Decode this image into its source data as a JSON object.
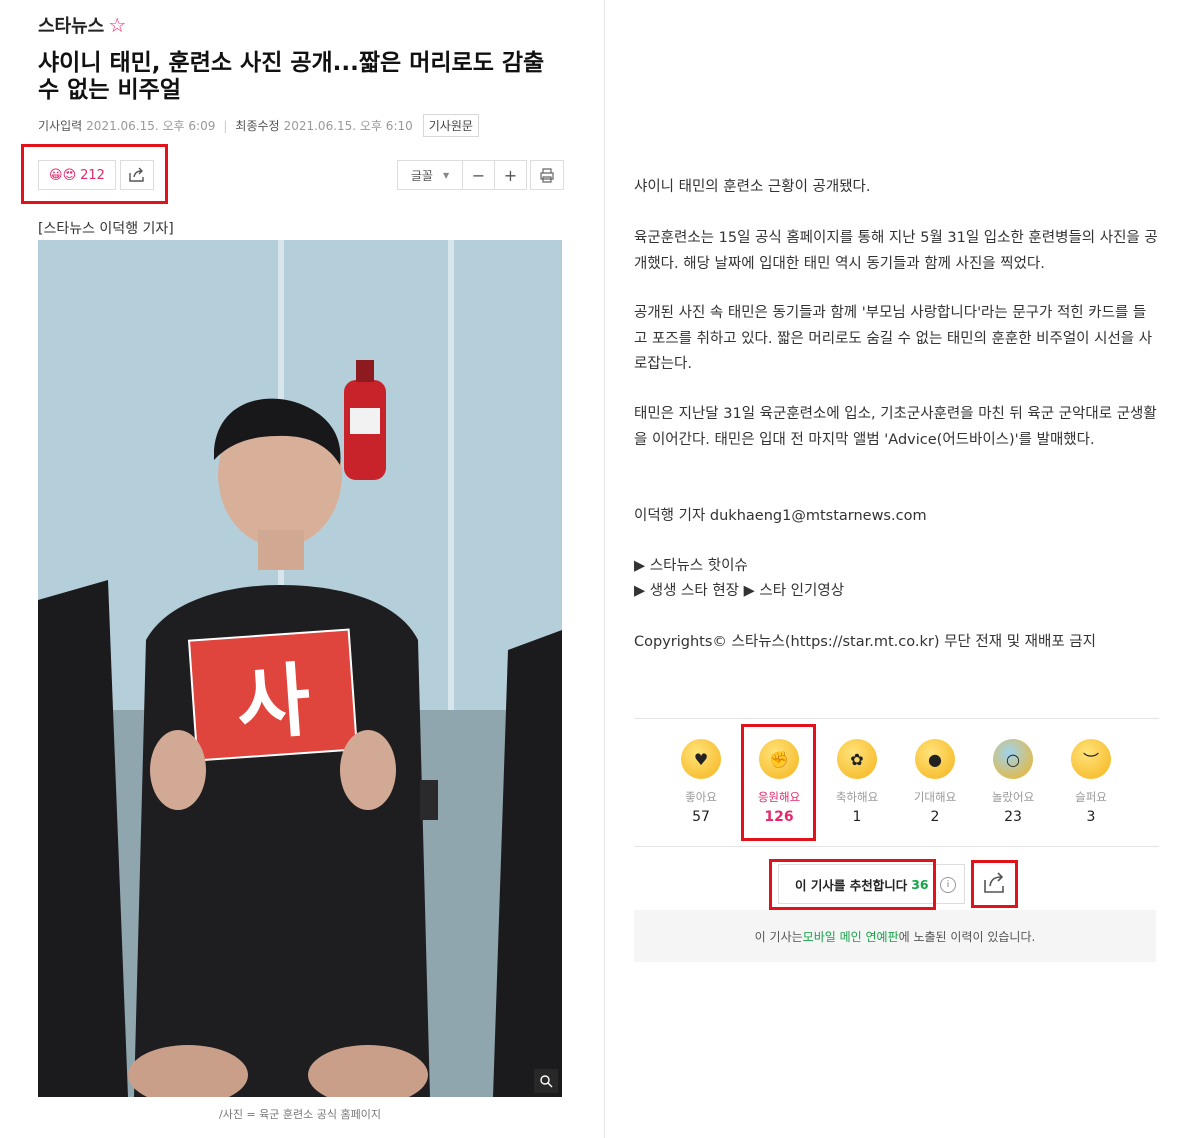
{
  "brand": {
    "name": "스타뉴스"
  },
  "article": {
    "title": "샤이니 태민, 훈련소 사진 공개...짧은 머리로도 감출 수 없는 비주얼",
    "input_label": "기사입력",
    "input_time": "2021.06.15. 오후 6:09",
    "modified_label": "최종수정",
    "modified_time": "2021.06.15. 오후 6:10",
    "origin_button": "기사원문",
    "byline": "[스타뉴스 이덕행 기자]",
    "photo_card_text": "사",
    "caption": "/사진 = 육군 훈련소 공식 홈페이지",
    "paragraphs": [
      "샤이니 태민의 훈련소 근황이 공개됐다.",
      "육군훈련소는 15일 공식 홈페이지를 통해 지난 5월 31일 입소한 훈련병들의 사진을 공개했다. 해당 날짜에 입대한 태민 역시 동기들과 함께 사진을 찍었다.",
      "공개된 사진 속 태민은 동기들과 함께 '부모님 사랑합니다'라는 문구가 적힌 카드를 들고 포즈를 취하고 있다. 짧은 머리로도 숨길 수 없는 태민의 훈훈한 비주얼이 시선을 사로잡는다.",
      "태민은 지난달 31일 육군훈련소에 입소, 기초군사훈련을 마친 뒤 육군 군악대로 군생활을 이어간다. 태민은 입대 전 마지막 앨범 'Advice(어드바이스)'를 발매했다.",
      "이덕행 기자 dukhaeng1@mtstarnews.com"
    ],
    "links": [
      "▶ 스타뉴스 핫이슈",
      "▶ 생생 스타 현장 ▶ 스타 인기영상"
    ],
    "copyright": "Copyrights© 스타뉴스(https://star.mt.co.kr) 무단 전재 및 재배포 금지"
  },
  "toolbar": {
    "reaction_total": "212",
    "font_label": "글꼴",
    "minus": "−",
    "plus": "+"
  },
  "reactions": [
    {
      "label": "좋아요",
      "count": "57"
    },
    {
      "label": "응원해요",
      "count": "126"
    },
    {
      "label": "축하해요",
      "count": "1"
    },
    {
      "label": "기대해요",
      "count": "2"
    },
    {
      "label": "놀랐어요",
      "count": "23"
    },
    {
      "label": "슬퍼요",
      "count": "3"
    }
  ],
  "recommend": {
    "label": "이 기사를 추천합니다",
    "count": "36",
    "info": "i"
  },
  "exposure": {
    "prefix": "이 기사는 ",
    "link": "모바일 메인 연예판",
    "suffix": "에 노출된 이력이 있습니다."
  },
  "colors": {
    "highlight_box": "#e2121a",
    "reaction_active": "#e3286b",
    "recommend_count": "#16a34a"
  }
}
